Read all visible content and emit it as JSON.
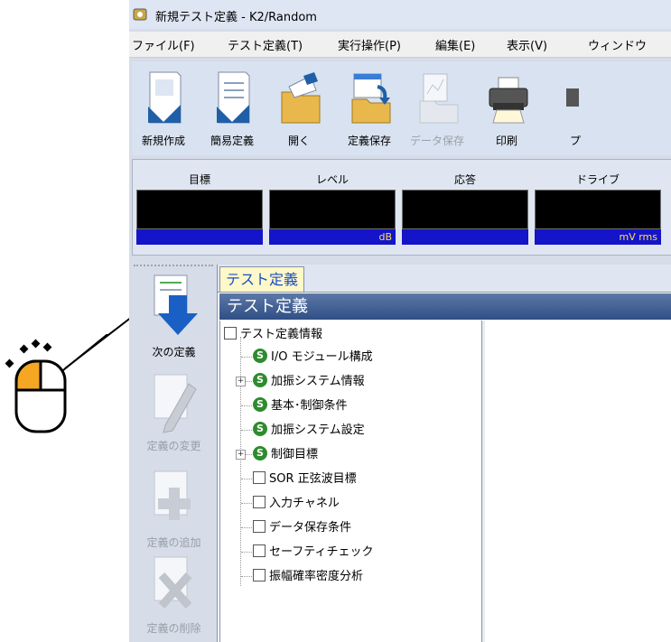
{
  "window": {
    "title": "新規テスト定義 - K2/Random"
  },
  "menu": [
    "ファイル(F)",
    "テスト定義(T)",
    "実行操作(P)",
    "編集(E)",
    "表示(V)",
    "ウィンドウ"
  ],
  "toolbar": {
    "new": "新規作成",
    "simple": "簡易定義",
    "open": "開く",
    "save_def": "定義保存",
    "save_data": "データ保存",
    "print": "印刷",
    "partial": "プ"
  },
  "meters": [
    {
      "label": "目標",
      "unit": ""
    },
    {
      "label": "レベル",
      "unit": "dB"
    },
    {
      "label": "応答",
      "unit": ""
    },
    {
      "label": "ドライブ",
      "unit": "mV rms"
    }
  ],
  "sidebar": {
    "next": "次の定義",
    "change": "定義の変更",
    "add": "定義の追加",
    "delete": "定義の削除"
  },
  "tab": "テスト定義",
  "panel_title": "テスト定義",
  "tree": {
    "root": "テスト定義情報",
    "items": [
      "I/O モジュール構成",
      "加振システム情報",
      "基本･制御条件",
      "加振システム設定",
      "制御目標",
      "SOR 正弦波目標",
      "入力チャネル",
      "データ保存条件",
      "セーフティチェック",
      "振幅確率密度分析"
    ],
    "s_icon_letter": "S"
  },
  "colors": {
    "accent_blue": "#1a5fc4",
    "status_green": "#2e8b2e",
    "mouse_highlight": "#f5a623"
  }
}
